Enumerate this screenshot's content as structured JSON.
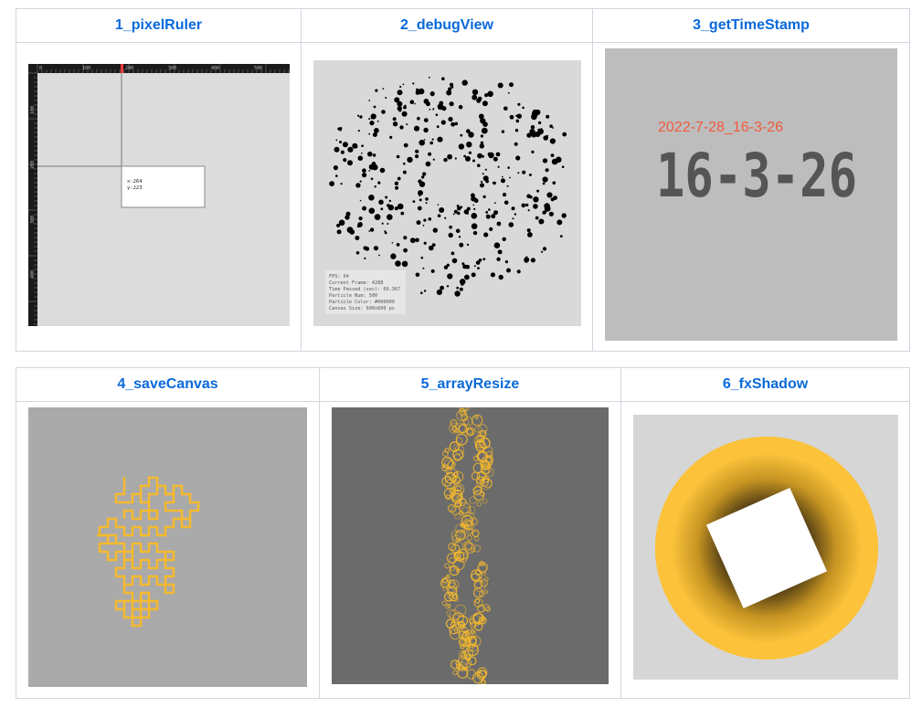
{
  "rows": [
    [
      {
        "title": "1_pixelRuler"
      },
      {
        "title": "2_debugView"
      },
      {
        "title": "3_getTimeStamp"
      }
    ],
    [
      {
        "title": "4_saveCanvas"
      },
      {
        "title": "5_arrayResize"
      },
      {
        "title": "6_fxShadow"
      }
    ]
  ],
  "pixelRuler": {
    "ruler_ticks": [
      "0",
      "100",
      "200",
      "300",
      "400",
      "500"
    ],
    "side_ticks": [
      "100",
      "200",
      "300",
      "400"
    ],
    "readout_x": "x:264",
    "readout_y": "y:223",
    "colors": {
      "ruler": "#1a1a1a",
      "canvas": "#dcdcdc",
      "mark": "#ff3b3b"
    }
  },
  "debugView": {
    "fps": "FPS: 64",
    "current_frame": "Current Frame: 4288",
    "time_passed": "Time Passed (sec): 69.367",
    "particle_num": "Particle Num: 500",
    "particle_color": "Particle Color: #000000",
    "canvas_size": "Canvas Size: 600x600 px",
    "colors": {
      "background": "#d9d9d9",
      "particle": "#000000"
    }
  },
  "timeStamp": {
    "date_string": "2022-7-28_16-3-26",
    "digits": "16-3-26",
    "colors": {
      "background": "#bdbdbd",
      "date": "#f05a3c",
      "digits": "#555555"
    }
  },
  "saveCanvas": {
    "colors": {
      "background": "#aaaaaa",
      "path": "#f5b92e"
    }
  },
  "arrayResize": {
    "colors": {
      "background": "#6b6b6b",
      "rings": "#f5b92e"
    }
  },
  "fxShadow": {
    "colors": {
      "background": "#d6d6d6",
      "circle": "#fbc23a",
      "square": "#ffffff"
    }
  }
}
